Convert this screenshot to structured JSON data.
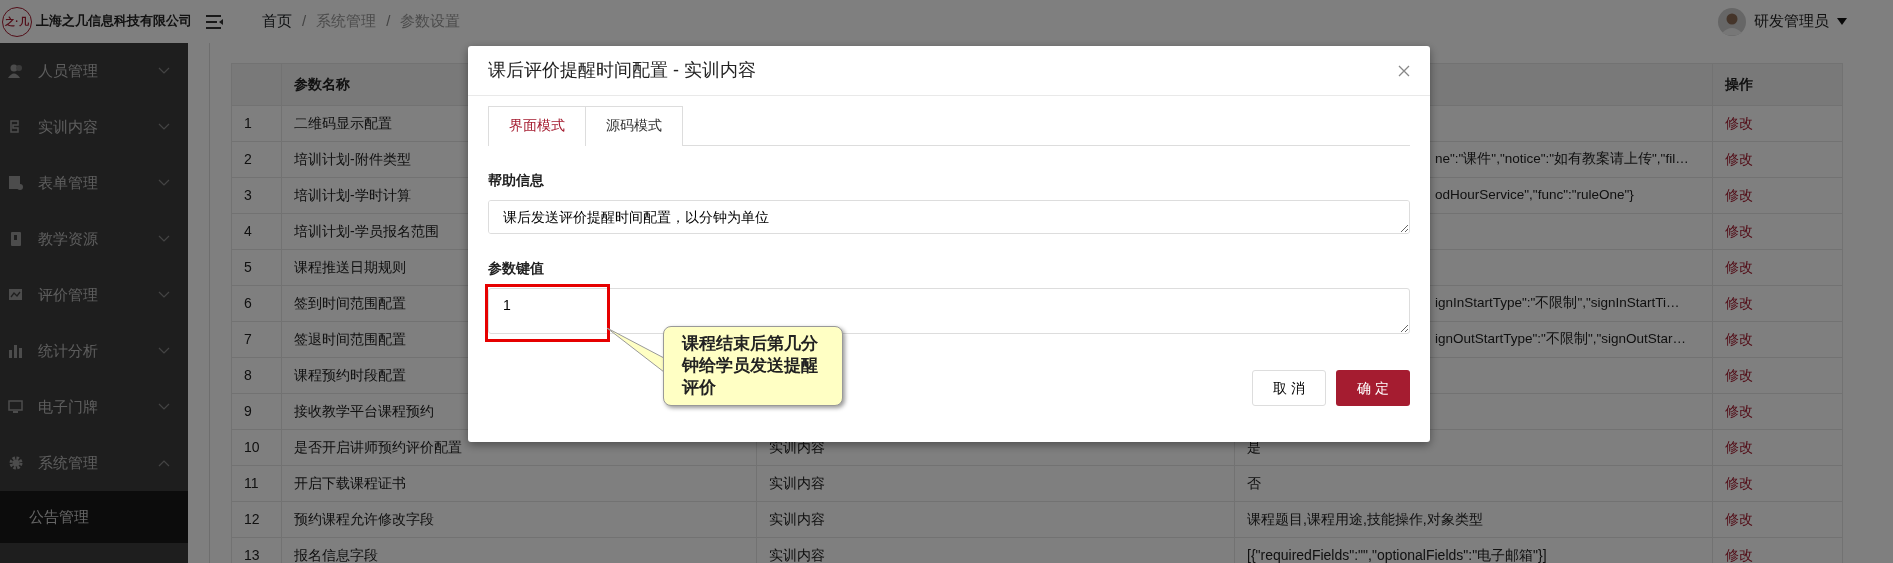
{
  "header": {
    "company": "上海之几信息科技有限公司",
    "logo_text": "之·几",
    "breadcrumb_separators": [
      "/",
      "/"
    ],
    "breadcrumb": [
      {
        "label": "首页"
      },
      {
        "label": "系统管理"
      },
      {
        "label": "参数设置"
      }
    ],
    "user": "研发管理员"
  },
  "sidebar": {
    "items": [
      {
        "label": "人员管理",
        "expanded": false
      },
      {
        "label": "实训内容",
        "expanded": false
      },
      {
        "label": "表单管理",
        "expanded": false
      },
      {
        "label": "教学资源",
        "expanded": false
      },
      {
        "label": "评价管理",
        "expanded": false
      },
      {
        "label": "统计分析",
        "expanded": false
      },
      {
        "label": "电子门牌",
        "expanded": false
      },
      {
        "label": "系统管理",
        "expanded": true,
        "children": [
          {
            "label": "公告管理"
          }
        ]
      }
    ]
  },
  "table": {
    "columns": [
      {},
      {
        "label": "参数名称"
      },
      {},
      {},
      {
        "label": "操作"
      }
    ],
    "rows": [
      {
        "index": "1",
        "name": "二维码显示配置",
        "action": "修改"
      },
      {
        "index": "2",
        "name": "培训计划-附件类型",
        "value": "ne\":\"课件\",\"notice\":\"如有教案请上传\",\"fil…",
        "value_covered": true,
        "action": "修改"
      },
      {
        "index": "3",
        "name": "培训计划-学时计算",
        "value": "odHourService\",\"func\":\"ruleOne\"}",
        "value_covered": true,
        "action": "修改"
      },
      {
        "index": "4",
        "name": "培训计划-学员报名范围",
        "action": "修改"
      },
      {
        "index": "5",
        "name": "课程推送日期规则",
        "action": "修改"
      },
      {
        "index": "6",
        "name": "签到时间范围配置",
        "value": "ignInStartType\":\"不限制\",\"signInStartTi…",
        "value_covered": true,
        "action": "修改"
      },
      {
        "index": "7",
        "name": "签退时间范围配置",
        "value": "ignOutStartType\":\"不限制\",\"signOutStar…",
        "value_covered": true,
        "action": "修改"
      },
      {
        "index": "8",
        "name": "课程预约时段配置",
        "action": "修改"
      },
      {
        "index": "9",
        "name": "接收教学平台课程预约",
        "action": "修改"
      },
      {
        "index": "10",
        "name": "是否开启讲师预约评价配置",
        "category": "实训内容",
        "value": "是",
        "value_covered": false,
        "action": "修改"
      },
      {
        "index": "11",
        "name": "开启下载课程证书",
        "category": "实训内容",
        "value": "否",
        "value_covered": false,
        "action": "修改"
      },
      {
        "index": "12",
        "name": "预约课程允许修改字段",
        "category": "实训内容",
        "value": "课程题目,课程用途,技能操作,对象类型",
        "value_covered": false,
        "action": "修改"
      },
      {
        "index": "13",
        "name": "报名信息字段",
        "category": "实训内容",
        "value": "[{\"requiredFields\":\"\",\"optionalFields\":\"电子邮箱\"}]",
        "value_covered": false,
        "action": "修改"
      }
    ]
  },
  "modal": {
    "title": "课后评价提醒时间配置 - 实训内容",
    "tabs": [
      {
        "label": "界面模式",
        "selected": true
      },
      {
        "label": "源码模式",
        "selected": false
      }
    ],
    "fields": [
      {
        "label": "帮助信息",
        "value": "课后发送评价提醒时间配置，以分钟为单位",
        "highlighted": false
      },
      {
        "label": "参数键值",
        "value": "1",
        "highlighted": true
      }
    ],
    "callout": "课程结束后第几分钟给学员发送提醒评价",
    "buttons": [
      {
        "label": "取 消",
        "kind": "secondary"
      },
      {
        "label": "确 定",
        "kind": "primary"
      }
    ]
  }
}
